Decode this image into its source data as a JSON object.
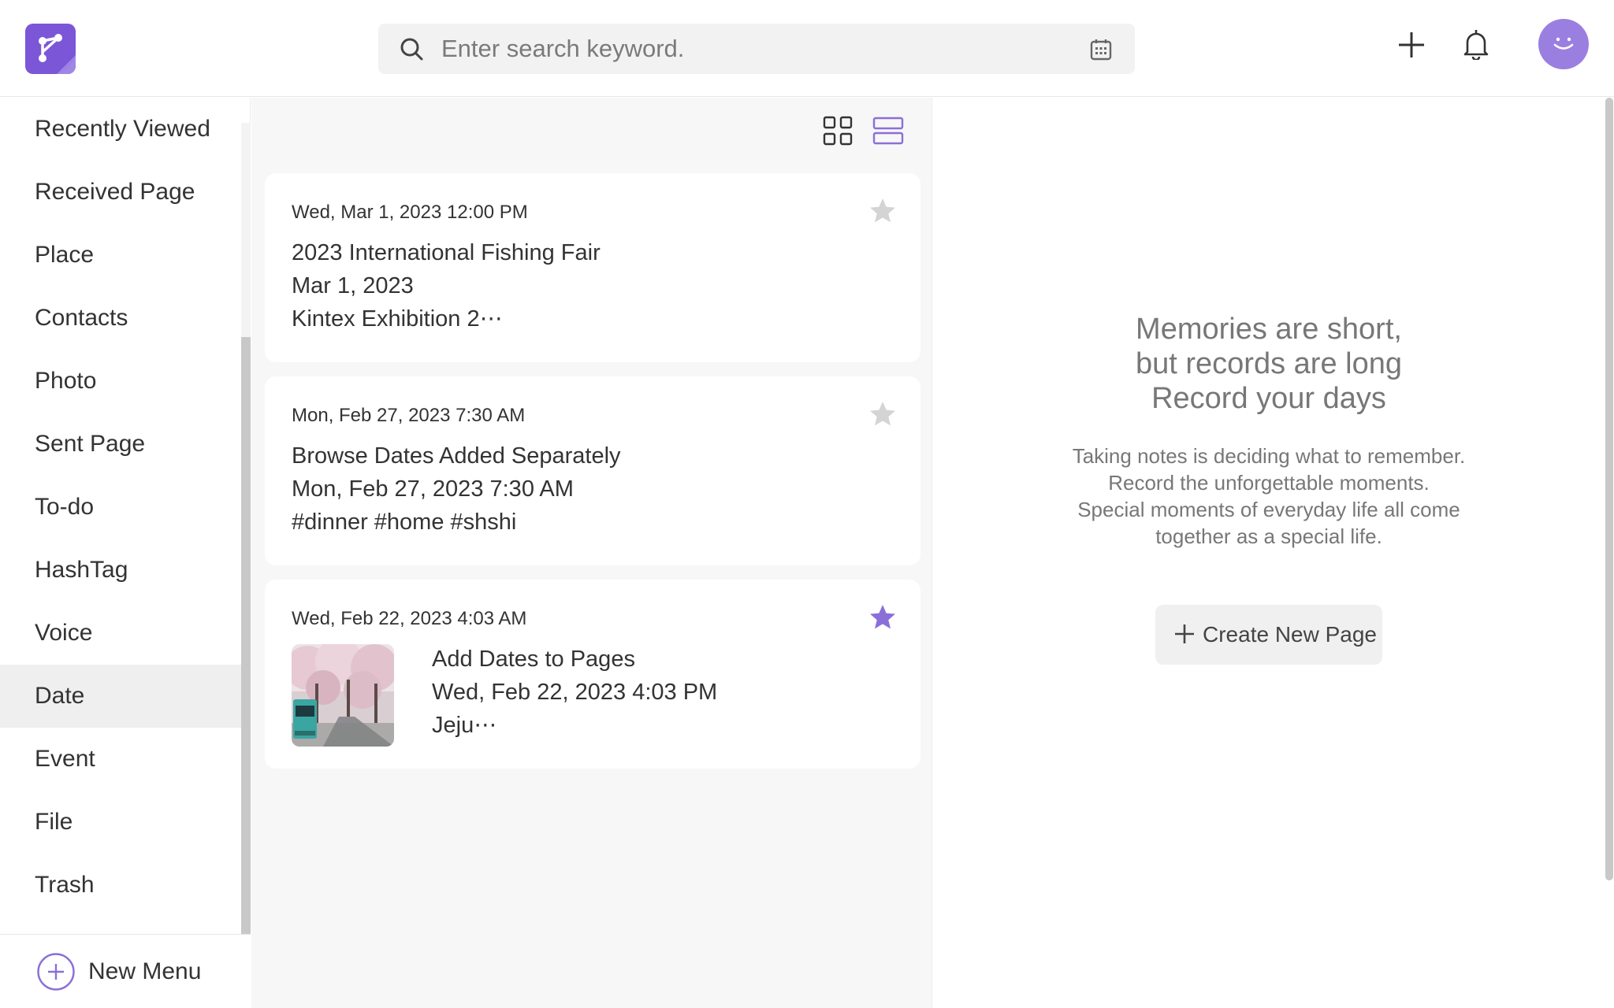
{
  "search": {
    "placeholder": "Enter search keyword."
  },
  "sidebar": {
    "items": [
      {
        "label": "Recently Viewed"
      },
      {
        "label": "Received Page"
      },
      {
        "label": "Place"
      },
      {
        "label": "Contacts"
      },
      {
        "label": "Photo"
      },
      {
        "label": "Sent Page"
      },
      {
        "label": "To-do"
      },
      {
        "label": "HashTag"
      },
      {
        "label": "Voice"
      },
      {
        "label": "Date",
        "active": true
      },
      {
        "label": "Event"
      },
      {
        "label": "File"
      },
      {
        "label": "Trash"
      }
    ],
    "new_menu_label": "New Menu"
  },
  "cards": [
    {
      "date": "Wed, Mar 1, 2023 12:00 PM",
      "lines": [
        "2023 International Fishing Fair",
        "Mar 1, 2023",
        "Kintex Exhibition 2⋯"
      ],
      "starred": false
    },
    {
      "date": "Mon, Feb 27, 2023 7:30 AM",
      "lines": [
        "Browse Dates Added Separately",
        "Mon, Feb 27, 2023 7:30 AM",
        "#dinner #home #shshi"
      ],
      "starred": false
    },
    {
      "date": "Wed, Feb 22, 2023 4:03 AM",
      "lines": [
        "Add Dates to Pages",
        "Wed, Feb 22, 2023 4:03 PM",
        "Jeju⋯"
      ],
      "starred": true
    }
  ],
  "empty_state": {
    "slogan": [
      "Memories are short,",
      "but records are long",
      "Record your days"
    ],
    "description": [
      "Taking notes is deciding what to remember.",
      "Record the unforgettable moments.",
      "Special moments of everyday life all come",
      "together as a special life."
    ],
    "create_button": "Create New Page"
  },
  "colors": {
    "accent": "#7b56d6",
    "avatar": "#9a7fe0",
    "star_active": "#8b6fd8",
    "star_inactive": "#d4d4d4",
    "active_item_bg": "#efefef"
  },
  "icons": [
    "app-logo",
    "search-icon",
    "calendar-icon",
    "plus-icon",
    "bell-icon",
    "avatar-smile-icon",
    "grid-view-icon",
    "list-view-icon",
    "star-icon",
    "add-circle-icon"
  ]
}
